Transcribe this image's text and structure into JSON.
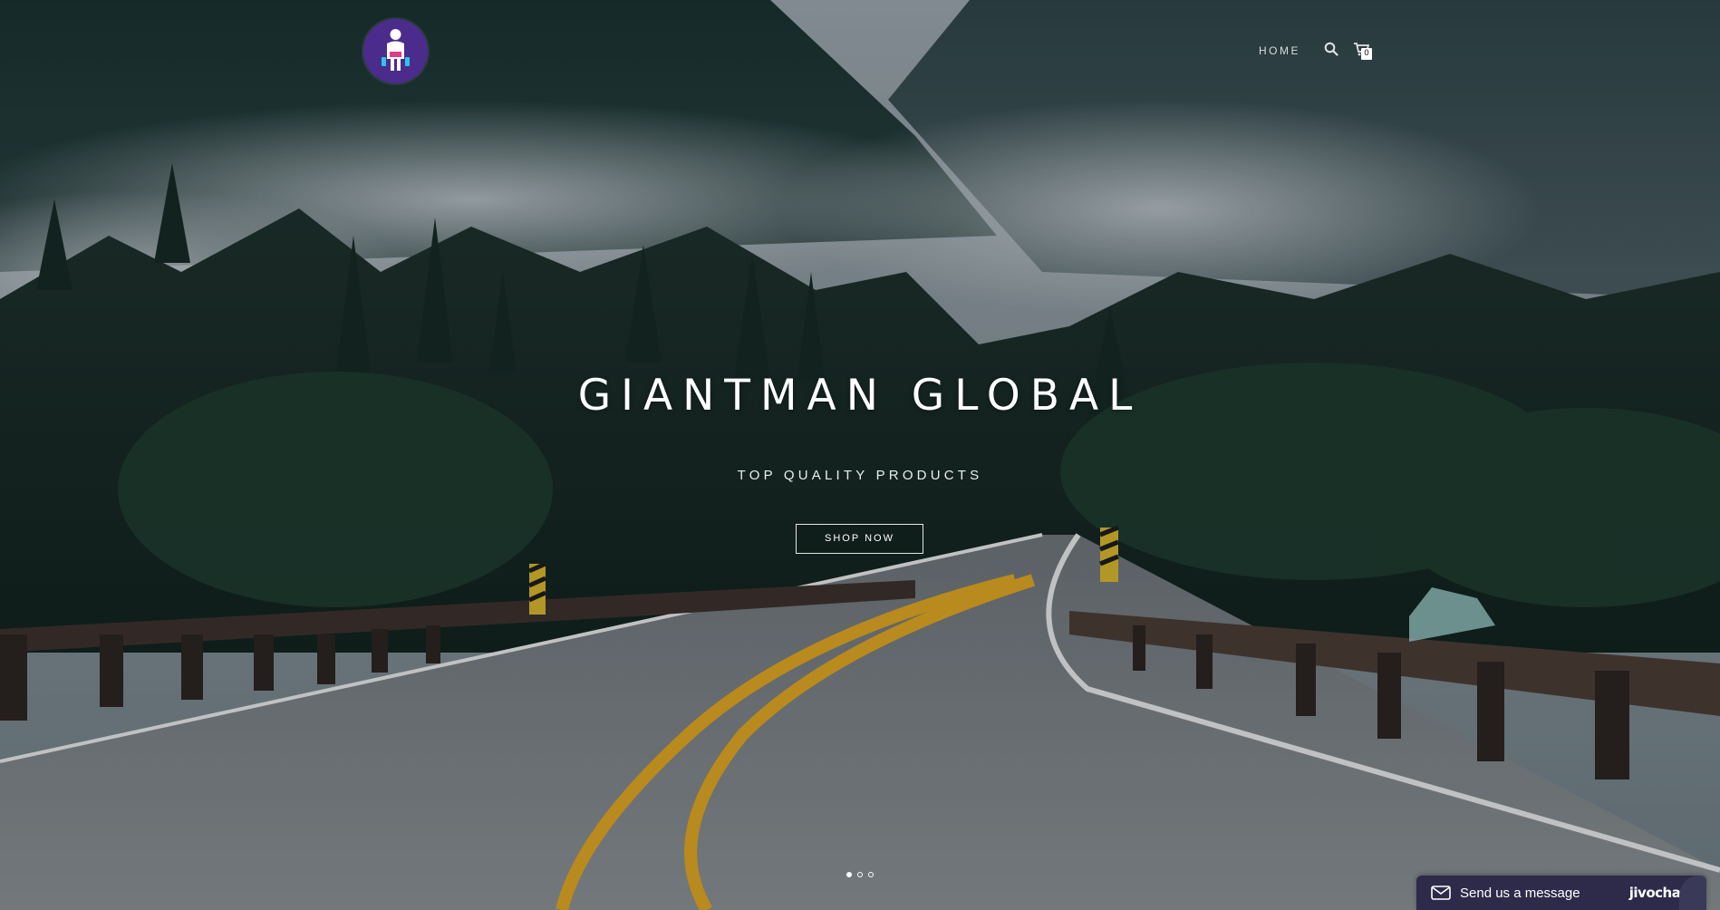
{
  "header": {
    "logo_icon": "person-with-bags-logo",
    "nav": {
      "home_label": "HOME"
    },
    "search_icon": "search-icon",
    "cart_icon": "cart-icon",
    "cart_count": "0"
  },
  "hero": {
    "title": "GIANTMAN GLOBAL",
    "subtitle": "TOP QUALITY PRODUCTS",
    "cta_label": "SHOP NOW",
    "slides": [
      "slide-1",
      "slide-2",
      "slide-3"
    ],
    "active_slide": 1
  },
  "chat": {
    "label": "Send us a message",
    "brand": "jivochat",
    "icon": "envelope-icon"
  },
  "colors": {
    "logo_bg": "#4b2b8c",
    "chat_bg": "#2d2a4a",
    "road_line": "#e0a520"
  }
}
